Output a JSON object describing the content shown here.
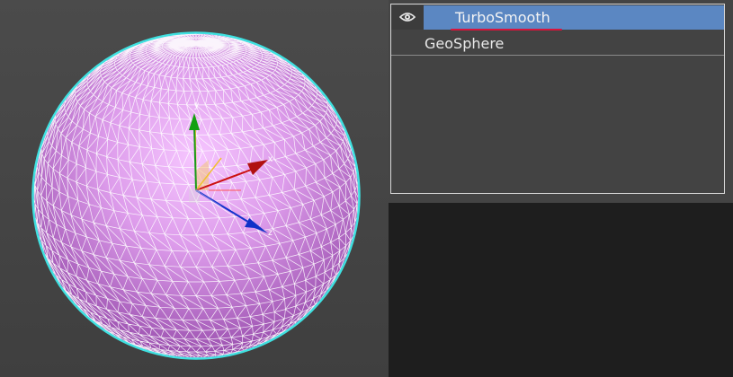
{
  "modifier_stack": {
    "items": [
      {
        "label": "TurboSmooth",
        "selected": true,
        "visibility_icon": "eye-icon"
      },
      {
        "label": "GeoSphere",
        "selected": false
      }
    ],
    "selection_color": "#5b87c2",
    "underline_color": "#d8143c"
  },
  "viewport": {
    "object": "sphere",
    "object_color": "#d99ae6",
    "wire_color": "#ffffff",
    "outline_color": "#3fe0e0",
    "gizmo_axes": [
      {
        "label": "x",
        "color": "#cc1111"
      },
      {
        "label": "y",
        "color": "#1a9a1a"
      },
      {
        "label": "z",
        "color": "#1133cc"
      }
    ]
  }
}
